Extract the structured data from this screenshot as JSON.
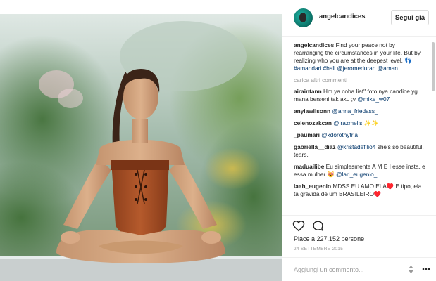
{
  "header": {
    "username": "angelcandices",
    "follow_label": "Segui già",
    "avatar_color": "#1fb8a8"
  },
  "caption": {
    "user": "angelcandices",
    "text": "Find your peace not by rearranging the circumstances in your life, But by realizing who you are at the deepest level.",
    "icon": "👣",
    "tags": "#amandari #bali @jeromeduran @aman"
  },
  "load_more": "carica altri commenti",
  "comments": [
    {
      "user": "airaintann",
      "text": "Hm ya coba liat\" foto nya candice yg mana berseni tak aku ;v",
      "mention": "@mike_w07"
    },
    {
      "user": "anyiawilsonn",
      "text": "",
      "mention": "@anna_friedass_"
    },
    {
      "user": "celenozakcan",
      "text": "",
      "mention": "@irazmelis ✨✨"
    },
    {
      "user": "_paumari",
      "text": "",
      "mention": "@kdorothytria"
    },
    {
      "user": "gabriella__diaz",
      "text": "she's so beautiful. tears.",
      "mention": "@kristadefilio4"
    },
    {
      "user": "maduailibe",
      "text": "Eu simplesmente A M E I esse insta, e essa mulher 😻",
      "mention": "@lari_eugenio_"
    },
    {
      "user": "laah_eugenio",
      "text": "MDSS EU AMO ELA♥️ E tipo, ela tá grávida de um BRASILEIRO♥️",
      "mention": ""
    }
  ],
  "actions": {
    "like_icon": "heart-outline-icon",
    "comment_icon": "speech-bubble-icon"
  },
  "likes_text": "Piace a 227.152 persone",
  "date_text": "24 SETTEMBRE 2015",
  "add_comment_placeholder": "Aggiungi un commento...",
  "colors": {
    "link": "#003569",
    "muted": "#999999",
    "border": "#efefef"
  }
}
